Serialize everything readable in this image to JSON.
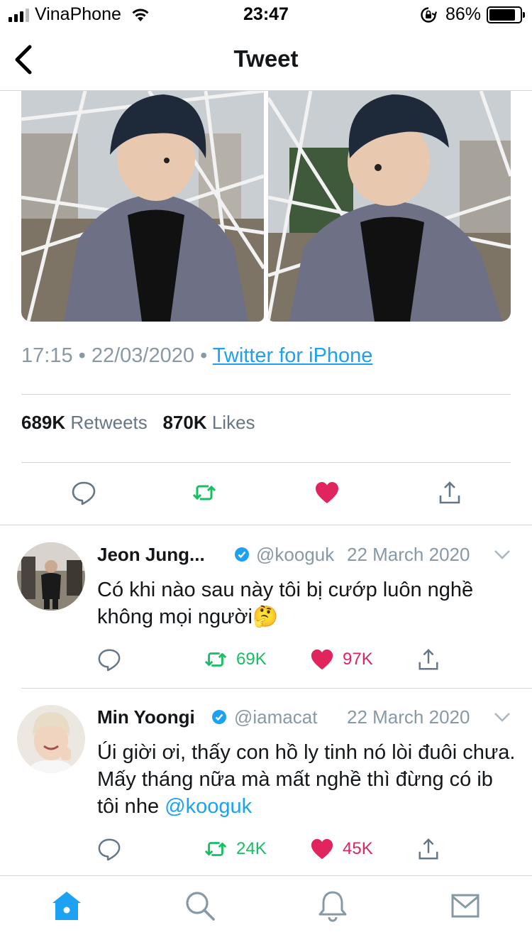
{
  "status_bar": {
    "carrier": "VinaPhone",
    "time": "23:47",
    "battery": "86%",
    "battery_level": 0.86,
    "icons": [
      "signal-icon",
      "wifi-icon",
      "rotation-lock-icon",
      "battery-icon"
    ]
  },
  "nav": {
    "title": "Tweet",
    "back_icon": "chevron-left-icon"
  },
  "tweet": {
    "time": "17:15",
    "sep1": "•",
    "date": "22/03/2020",
    "sep2": "•",
    "source": "Twitter for iPhone",
    "retweets_count": "689K",
    "retweets_label": "Retweets",
    "likes_count": "870K",
    "likes_label": "Likes",
    "liked": true,
    "actions": [
      "reply-icon",
      "retweet-icon",
      "heart-icon",
      "share-icon"
    ]
  },
  "replies": [
    {
      "name": "Jeon Jung...",
      "verified": true,
      "handle": "@kooguk",
      "date": "22 March 2020",
      "text": "Có khi nào sau này tôi bị cướp luôn nghề không mọi người🤔",
      "retweets": "69K",
      "likes": "97K"
    },
    {
      "name": "Min Yoongi",
      "verified": true,
      "handle": "@iamacat",
      "date": "22 March 2020",
      "text": "Úi giời ơi, thấy con hồ ly tinh nó lòi đuôi chưa. Mấy tháng nữa mà mất nghề thì đừng có ib tôi nhe",
      "mention": "@kooguk",
      "retweets": "24K",
      "likes": "45K"
    }
  ],
  "tab_bar": {
    "tabs": [
      "home-icon",
      "search-icon",
      "bell-icon",
      "mail-icon"
    ],
    "active": "home-icon"
  },
  "colors": {
    "accent": "#1da1f2",
    "like": "#e0245e",
    "retweet": "#17bf63",
    "secondary_text": "#8899a6",
    "divider": "#ccd6dd"
  }
}
